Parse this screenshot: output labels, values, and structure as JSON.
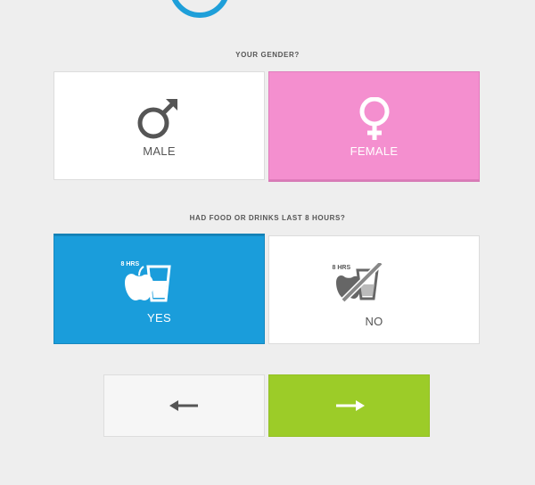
{
  "gender": {
    "question": "YOUR GENDER?",
    "options": [
      {
        "label": "MALE",
        "selected": false
      },
      {
        "label": "FEMALE",
        "selected": true
      }
    ]
  },
  "food": {
    "question": "HAD FOOD OR DRINKS LAST 8 HOURS?",
    "options": [
      {
        "label": "YES",
        "badge": "8 HRS",
        "selected": true
      },
      {
        "label": "NO",
        "badge": "8 HRS",
        "selected": false
      }
    ]
  },
  "nav": {
    "back_icon": "arrow-left-icon",
    "next_icon": "arrow-right-icon"
  },
  "colors": {
    "accent_blue": "#1a9ddb",
    "female_pink": "#f48fcf",
    "next_green": "#9ccc28"
  }
}
